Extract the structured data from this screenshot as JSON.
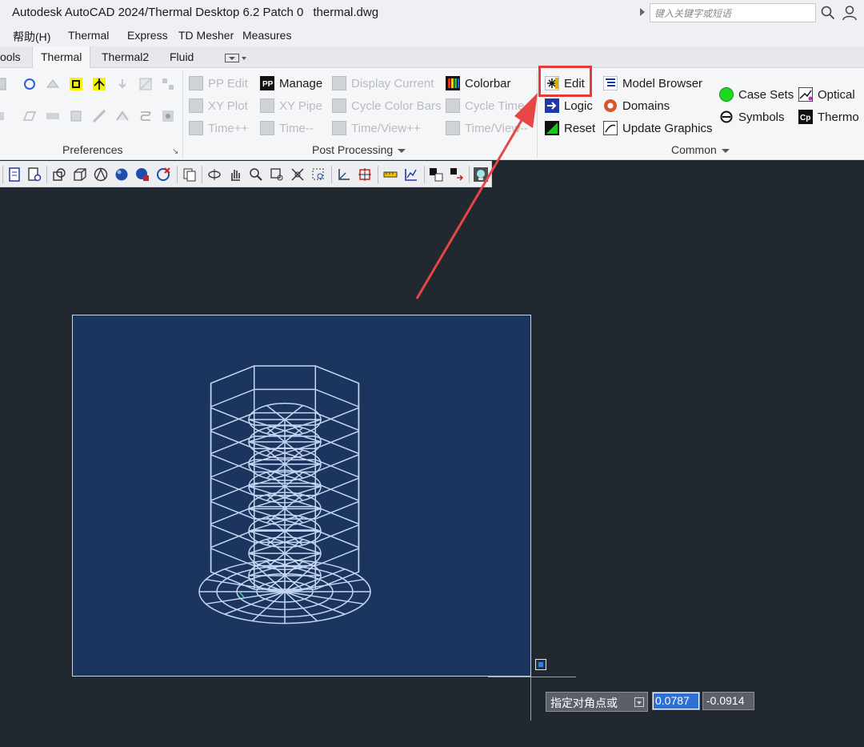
{
  "window": {
    "title": "Autodesk AutoCAD 2024/Thermal Desktop 6.2 Patch 0",
    "filename": "thermal.dwg",
    "search_placeholder": "键入关键字或短语"
  },
  "menu": [
    "帮助(H)",
    "Thermal",
    "Express",
    "TD Mesher",
    "Measures"
  ],
  "tabs": [
    "ools",
    "Thermal",
    "Thermal2",
    "Fluid"
  ],
  "active_tab": "Thermal",
  "ribbon": {
    "preferences": {
      "label": "Preferences"
    },
    "post_processing": {
      "label": "Post Processing",
      "buttons": [
        {
          "label": "PP Edit",
          "enabled": false
        },
        {
          "label": "XY Plot",
          "enabled": false
        },
        {
          "label": "Time++",
          "enabled": false
        },
        {
          "label": "Manage",
          "enabled": true
        },
        {
          "label": "XY Pipe",
          "enabled": false
        },
        {
          "label": "Time--",
          "enabled": false
        },
        {
          "label": "Display Current",
          "enabled": false
        },
        {
          "label": "Cycle Color Bars",
          "enabled": false
        },
        {
          "label": "Time/View++",
          "enabled": false
        },
        {
          "label": "Colorbar",
          "enabled": true
        },
        {
          "label": "Cycle Time",
          "enabled": false
        },
        {
          "label": "Time/View--",
          "enabled": false
        }
      ]
    },
    "common": {
      "label": "Common",
      "buttons": [
        {
          "label": "Edit",
          "enabled": true
        },
        {
          "label": "Logic",
          "enabled": true
        },
        {
          "label": "Reset",
          "enabled": true
        },
        {
          "label": "Model Browser",
          "enabled": true
        },
        {
          "label": "Domains",
          "enabled": true
        },
        {
          "label": "Update Graphics",
          "enabled": true
        },
        {
          "label": "Case Sets",
          "enabled": true
        },
        {
          "label": "Symbols",
          "enabled": true
        },
        {
          "label": "Optical",
          "enabled": true
        },
        {
          "label": "Thermo",
          "enabled": true
        }
      ]
    }
  },
  "dynamic_input": {
    "prompt": "指定对角点或",
    "x_value": "0.0787",
    "y_value": "-0.0914"
  },
  "colors": {
    "highlight": "#e53b3b",
    "canvas_bg": "#212830",
    "viewport_bg": "#1c355e",
    "wireframe": "#c5d6f2"
  }
}
